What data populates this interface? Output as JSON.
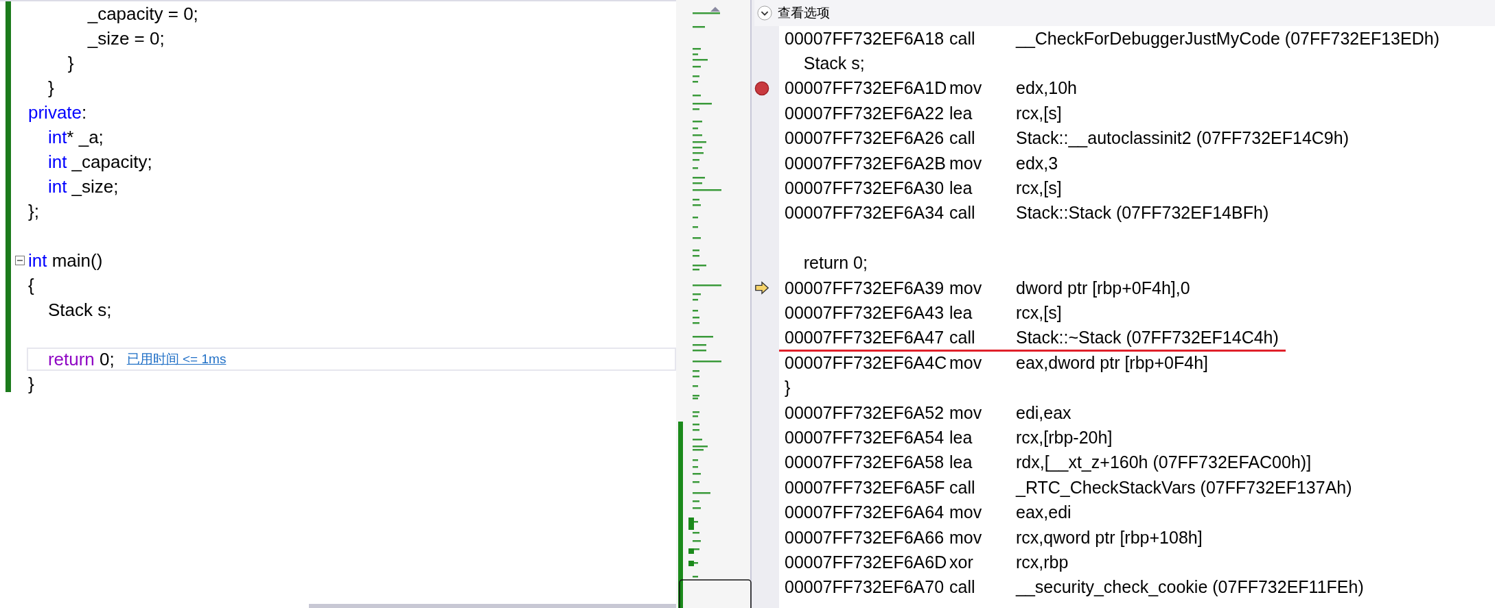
{
  "editor": {
    "lines": [
      {
        "segments": [
          {
            "kind": "plain",
            "text": "            _capacity = 0;"
          }
        ],
        "fold": false,
        "current": false
      },
      {
        "segments": [
          {
            "kind": "plain",
            "text": "            _size = 0;"
          }
        ],
        "fold": false,
        "current": false
      },
      {
        "segments": [
          {
            "kind": "plain",
            "text": "        }"
          }
        ],
        "fold": false,
        "current": false
      },
      {
        "segments": [
          {
            "kind": "plain",
            "text": "    }"
          }
        ],
        "fold": false,
        "current": false
      },
      {
        "segments": [
          {
            "kind": "keyword",
            "text": "private"
          },
          {
            "kind": "plain",
            "text": ":"
          }
        ],
        "fold": false,
        "current": false
      },
      {
        "segments": [
          {
            "kind": "keyword",
            "text": "    int"
          },
          {
            "kind": "plain",
            "text": "* _a;"
          }
        ],
        "fold": false,
        "current": false
      },
      {
        "segments": [
          {
            "kind": "keyword",
            "text": "    int"
          },
          {
            "kind": "plain",
            "text": " _capacity;"
          }
        ],
        "fold": false,
        "current": false
      },
      {
        "segments": [
          {
            "kind": "keyword",
            "text": "    int"
          },
          {
            "kind": "plain",
            "text": " _size;"
          }
        ],
        "fold": false,
        "current": false
      },
      {
        "segments": [
          {
            "kind": "plain",
            "text": "};"
          }
        ],
        "fold": false,
        "current": false
      },
      {
        "fold": false,
        "current": false
      },
      {
        "segments": [
          {
            "kind": "keyword",
            "text": "int"
          },
          {
            "kind": "plain",
            "text": " main()"
          }
        ],
        "fold": true,
        "current": false
      },
      {
        "segments": [
          {
            "kind": "plain",
            "text": "{"
          }
        ],
        "fold": false,
        "current": false
      },
      {
        "segments": [
          {
            "kind": "plain",
            "text": "    Stack s;"
          }
        ],
        "fold": false,
        "current": false
      },
      {
        "fold": false,
        "current": false
      },
      {
        "segments": [
          {
            "kind": "control",
            "text": "    return"
          },
          {
            "kind": "plain",
            "text": " 0;"
          }
        ],
        "fold": false,
        "current": true,
        "hint": "已用时间 <= 1ms"
      },
      {
        "segments": [
          {
            "kind": "plain",
            "text": "}"
          }
        ],
        "fold": false,
        "current": false
      }
    ]
  },
  "disassembly": {
    "header": {
      "label": "查看选项"
    },
    "rows": [
      {
        "kind": "instruction",
        "address": "00007FF732EF6A18",
        "mnemonic": "call",
        "operand": "__CheckForDebuggerJustMyCode (07FF732EF13EDh)",
        "breakpoint": false,
        "current": false,
        "underlined": false
      },
      {
        "kind": "source",
        "text": "    Stack s;"
      },
      {
        "kind": "instruction",
        "address": "00007FF732EF6A1D",
        "mnemonic": "mov",
        "operand": "edx,10h",
        "breakpoint": true,
        "current": false,
        "underlined": false
      },
      {
        "kind": "instruction",
        "address": "00007FF732EF6A22",
        "mnemonic": "lea",
        "operand": "rcx,[s]",
        "breakpoint": false,
        "current": false,
        "underlined": false
      },
      {
        "kind": "instruction",
        "address": "00007FF732EF6A26",
        "mnemonic": "call",
        "operand": "Stack::__autoclassinit2 (07FF732EF14C9h)",
        "breakpoint": false,
        "current": false,
        "underlined": false
      },
      {
        "kind": "instruction",
        "address": "00007FF732EF6A2B",
        "mnemonic": "mov",
        "operand": "edx,3",
        "breakpoint": false,
        "current": false,
        "underlined": false
      },
      {
        "kind": "instruction",
        "address": "00007FF732EF6A30",
        "mnemonic": "lea",
        "operand": "rcx,[s]",
        "breakpoint": false,
        "current": false,
        "underlined": false
      },
      {
        "kind": "instruction",
        "address": "00007FF732EF6A34",
        "mnemonic": "call",
        "operand": "Stack::Stack (07FF732EF14BFh)",
        "breakpoint": false,
        "current": false,
        "underlined": false
      },
      {
        "kind": "blank"
      },
      {
        "kind": "source",
        "text": "    return 0;"
      },
      {
        "kind": "instruction",
        "address": "00007FF732EF6A39",
        "mnemonic": "mov",
        "operand": "dword ptr [rbp+0F4h],0",
        "breakpoint": false,
        "current": true,
        "underlined": false
      },
      {
        "kind": "instruction",
        "address": "00007FF732EF6A43",
        "mnemonic": "lea",
        "operand": "rcx,[s]",
        "breakpoint": false,
        "current": false,
        "underlined": false
      },
      {
        "kind": "instruction",
        "address": "00007FF732EF6A47",
        "mnemonic": "call",
        "operand": "Stack::~Stack (07FF732EF14C4h)",
        "breakpoint": false,
        "current": false,
        "underlined": true
      },
      {
        "kind": "instruction",
        "address": "00007FF732EF6A4C",
        "mnemonic": "mov",
        "operand": "eax,dword ptr [rbp+0F4h]",
        "breakpoint": false,
        "current": false,
        "underlined": false
      },
      {
        "kind": "source",
        "text": "}"
      },
      {
        "kind": "instruction",
        "address": "00007FF732EF6A52",
        "mnemonic": "mov",
        "operand": "edi,eax",
        "breakpoint": false,
        "current": false,
        "underlined": false
      },
      {
        "kind": "instruction",
        "address": "00007FF732EF6A54",
        "mnemonic": "lea",
        "operand": "rcx,[rbp-20h]",
        "breakpoint": false,
        "current": false,
        "underlined": false
      },
      {
        "kind": "instruction",
        "address": "00007FF732EF6A58",
        "mnemonic": "lea",
        "operand": "rdx,[__xt_z+160h (07FF732EFAC00h)]",
        "breakpoint": false,
        "current": false,
        "underlined": false
      },
      {
        "kind": "instruction",
        "address": "00007FF732EF6A5F",
        "mnemonic": "call",
        "operand": "_RTC_CheckStackVars (07FF732EF137Ah)",
        "breakpoint": false,
        "current": false,
        "underlined": false
      },
      {
        "kind": "instruction",
        "address": "00007FF732EF6A64",
        "mnemonic": "mov",
        "operand": "eax,edi",
        "breakpoint": false,
        "current": false,
        "underlined": false
      },
      {
        "kind": "instruction",
        "address": "00007FF732EF6A66",
        "mnemonic": "mov",
        "operand": "rcx,qword ptr [rbp+108h]",
        "breakpoint": false,
        "current": false,
        "underlined": false
      },
      {
        "kind": "instruction",
        "address": "00007FF732EF6A6D",
        "mnemonic": "xor",
        "operand": "rcx,rbp",
        "breakpoint": false,
        "current": false,
        "underlined": false
      },
      {
        "kind": "instruction",
        "address": "00007FF732EF6A70",
        "mnemonic": "call",
        "operand": "__security_check_cookie (07FF732EF11FEh)",
        "breakpoint": false,
        "current": false,
        "underlined": false
      }
    ]
  }
}
